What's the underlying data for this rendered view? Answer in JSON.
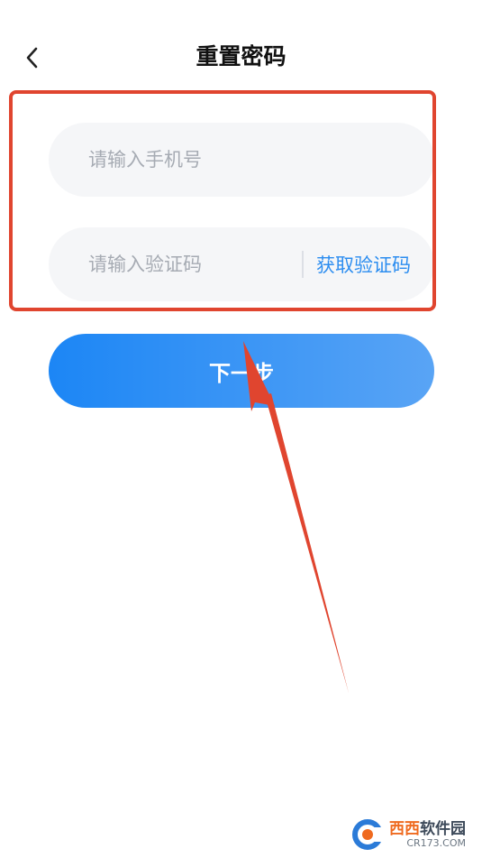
{
  "header": {
    "title": "重置密码",
    "back_icon": "chevron-left-icon"
  },
  "form": {
    "phone": {
      "placeholder": "请输入手机号",
      "value": ""
    },
    "code": {
      "placeholder": "请输入验证码",
      "value": "",
      "get_code_label": "获取验证码"
    }
  },
  "next_button": {
    "label": "下一步"
  },
  "watermark": {
    "name_part1": "西西",
    "name_part2": "软件园",
    "site": "CR173.COM"
  },
  "colors": {
    "accent": "#2c8df0",
    "annotation": "#e0452f",
    "input_bg": "#f5f6f8",
    "button_gradient_start": "#1c86f5",
    "button_gradient_end": "#59a4f5"
  }
}
